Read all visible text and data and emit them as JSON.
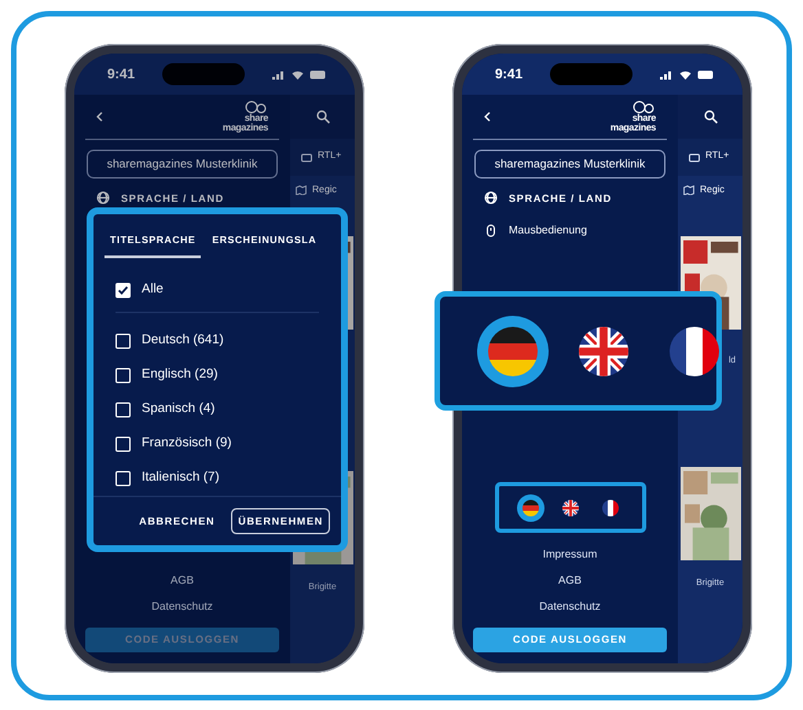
{
  "phones": [
    {
      "time": "9:41",
      "dimmed": true,
      "sidebar": {
        "logo": [
          "share",
          "magazines"
        ],
        "account": "sharemagazines Musterklinik",
        "menu": [
          {
            "kind": "heading",
            "label": "SPRACHE / LAND"
          }
        ],
        "links": [
          "AGB",
          "Datenschutz"
        ],
        "logout": "CODE AUSLOGGEN"
      },
      "content": {
        "chips": [
          {
            "label": "RTL+"
          },
          {
            "label": "Regic"
          }
        ],
        "covers": [
          {
            "kind": "picture"
          },
          {
            "kind": "picture",
            "caption": "Brigitte"
          }
        ]
      },
      "dialog": {
        "tabs": [
          {
            "label": "TITELSPRACHE",
            "selected": true
          },
          {
            "label": "ERSCHEINUNGSLA",
            "selected": false
          }
        ],
        "options": [
          {
            "label": "Alle",
            "checked": true,
            "kind": "all"
          },
          {
            "label": "Deutsch (641)",
            "checked": false,
            "kind": "option"
          },
          {
            "label": "Englisch (29)",
            "checked": false,
            "kind": "option"
          },
          {
            "label": "Spanisch (4)",
            "checked": false,
            "kind": "option"
          },
          {
            "label": "Französisch (9)",
            "checked": false,
            "kind": "option"
          },
          {
            "label": "Italienisch (7)",
            "checked": false,
            "kind": "option"
          }
        ],
        "buttons": [
          {
            "label": "ABBRECHEN",
            "kind": "text"
          },
          {
            "label": "ÜBERNEHMEN",
            "kind": "outline"
          }
        ]
      }
    },
    {
      "time": "9:41",
      "dimmed": false,
      "sidebar": {
        "logo": [
          "share",
          "magazines"
        ],
        "account": "sharemagazines Musterklinik",
        "menu": [
          {
            "kind": "heading",
            "label": "SPRACHE / LAND"
          },
          {
            "kind": "item",
            "label": "Mausbedienung"
          }
        ],
        "flags": [
          {
            "kind": "de",
            "selected": true
          },
          {
            "kind": "gb",
            "selected": false
          },
          {
            "kind": "fr",
            "selected": false
          }
        ],
        "links": [
          "Impressum",
          "AGB",
          "Datenschutz"
        ],
        "logout": "CODE AUSLOGGEN"
      },
      "content": {
        "chips": [
          {
            "label": "RTL+"
          },
          {
            "label": "Regic"
          }
        ],
        "covers": [
          {
            "kind": "picture",
            "caption": "ld"
          },
          {
            "kind": "picture",
            "caption": "Brigitte"
          }
        ]
      },
      "callout": {
        "flags": [
          {
            "kind": "de",
            "selected": true
          },
          {
            "kind": "gb",
            "selected": false
          },
          {
            "kind": "fr",
            "selected": false
          }
        ]
      }
    }
  ]
}
